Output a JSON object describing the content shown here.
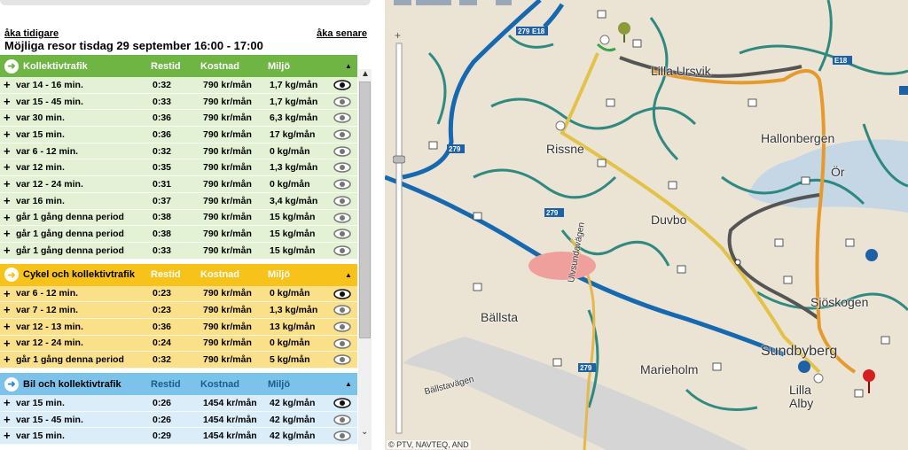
{
  "nav": {
    "earlier": "åka tidigare",
    "later": "åka senare"
  },
  "headline": "Möjliga resor tisdag 29 september 16:00 - 17:00",
  "columns": {
    "restid": "Restid",
    "kostnad": "Kostnad",
    "miljo": "Miljö"
  },
  "groups": [
    {
      "title": "Kollektivtrafik",
      "rows": [
        {
          "freq": "var 14 - 16 min.",
          "restid": "0:32",
          "kostnad": "790 kr/mån",
          "miljo": "1,7 kg/mån"
        },
        {
          "freq": "var 15 - 45 min.",
          "restid": "0:33",
          "kostnad": "790 kr/mån",
          "miljo": "1,7 kg/mån"
        },
        {
          "freq": "var 30 min.",
          "restid": "0:36",
          "kostnad": "790 kr/mån",
          "miljo": "6,3 kg/mån"
        },
        {
          "freq": "var 15 min.",
          "restid": "0:36",
          "kostnad": "790 kr/mån",
          "miljo": "17 kg/mån"
        },
        {
          "freq": "var 6 - 12 min.",
          "restid": "0:32",
          "kostnad": "790 kr/mån",
          "miljo": "0 kg/mån"
        },
        {
          "freq": "var 12 min.",
          "restid": "0:35",
          "kostnad": "790 kr/mån",
          "miljo": "1,3 kg/mån"
        },
        {
          "freq": "var 12 - 24 min.",
          "restid": "0:31",
          "kostnad": "790 kr/mån",
          "miljo": "0 kg/mån"
        },
        {
          "freq": "var 16 min.",
          "restid": "0:37",
          "kostnad": "790 kr/mån",
          "miljo": "3,4 kg/mån"
        },
        {
          "freq": "går 1 gång denna period",
          "restid": "0:38",
          "kostnad": "790 kr/mån",
          "miljo": "15 kg/mån"
        },
        {
          "freq": "går 1 gång denna period",
          "restid": "0:38",
          "kostnad": "790 kr/mån",
          "miljo": "15 kg/mån"
        },
        {
          "freq": "går 1 gång denna period",
          "restid": "0:33",
          "kostnad": "790 kr/mån",
          "miljo": "15 kg/mån"
        }
      ]
    },
    {
      "title": "Cykel och kollektivtrafik",
      "rows": [
        {
          "freq": "var 6 - 12 min.",
          "restid": "0:23",
          "kostnad": "790 kr/mån",
          "miljo": "0 kg/mån"
        },
        {
          "freq": "var 7 - 12 min.",
          "restid": "0:23",
          "kostnad": "790 kr/mån",
          "miljo": "1,3 kg/mån"
        },
        {
          "freq": "var 12 - 13 min.",
          "restid": "0:36",
          "kostnad": "790 kr/mån",
          "miljo": "13 kg/mån"
        },
        {
          "freq": "var 12 - 24 min.",
          "restid": "0:24",
          "kostnad": "790 kr/mån",
          "miljo": "0 kg/mån"
        },
        {
          "freq": "går 1 gång denna period",
          "restid": "0:32",
          "kostnad": "790 kr/mån",
          "miljo": "5 kg/mån"
        }
      ]
    },
    {
      "title": "Bil och kollektivtrafik",
      "rows": [
        {
          "freq": "var 15 min.",
          "restid": "0:26",
          "kostnad": "1454 kr/mån",
          "miljo": "42 kg/mån"
        },
        {
          "freq": "var 15 - 45 min.",
          "restid": "0:26",
          "kostnad": "1454 kr/mån",
          "miljo": "42 kg/mån"
        },
        {
          "freq": "var 15 min.",
          "restid": "0:29",
          "kostnad": "1454 kr/mån",
          "miljo": "42 kg/mån"
        }
      ]
    }
  ],
  "map": {
    "credit": "© PTV, NAVTEQ, AND",
    "places": [
      "Lilla Ursvik",
      "Rissne",
      "Hallonbergen",
      "Duvbo",
      "Ör",
      "Sjöskogen",
      "Sundbyberg",
      "Bällsta",
      "Marieholm",
      "Lilla Alby",
      "Ulvsundavägen",
      "Bällstavägen"
    ],
    "roads": [
      "279",
      "E18",
      "279",
      "279",
      "279",
      "E18"
    ]
  }
}
